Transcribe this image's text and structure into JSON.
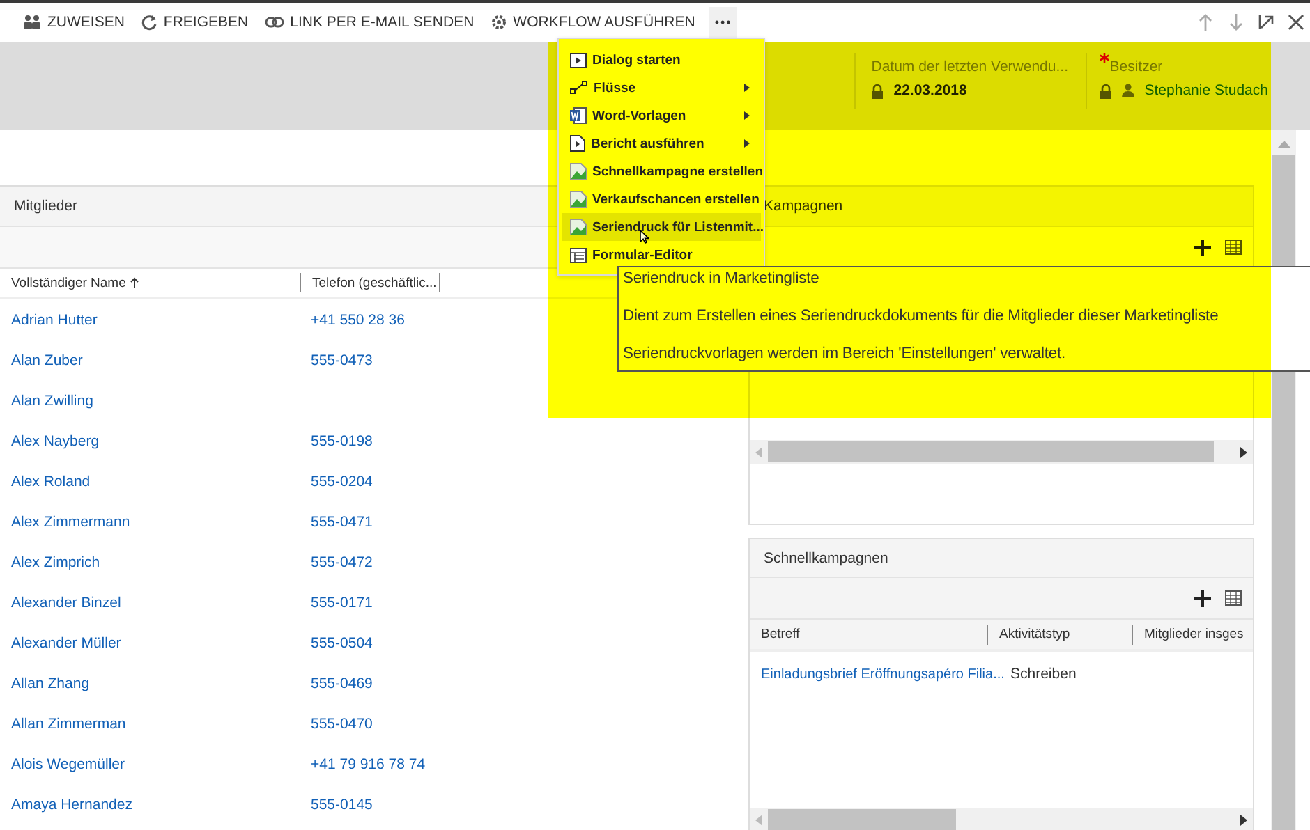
{
  "toolbar": {
    "commands": [
      {
        "label": "ZUWEISEN",
        "kind": "assign"
      },
      {
        "label": "FREIGEBEN",
        "kind": "share"
      },
      {
        "label": "LINK PER E-MAIL SENDEN",
        "kind": "link"
      },
      {
        "label": "WORKFLOW AUSFÜHREN",
        "kind": "workflow"
      }
    ],
    "more": "•••"
  },
  "header": {
    "fields": [
      {
        "label": "Datum der letzten Verwendu...",
        "value": "22.03.2018",
        "locked": true,
        "required": false,
        "kind": "text"
      },
      {
        "label": "Besitzer",
        "value": "Stephanie Studach",
        "locked": true,
        "required": true,
        "kind": "lookup"
      }
    ]
  },
  "members": {
    "title": "Mitglieder",
    "columns": [
      {
        "label": "Vollständiger Name",
        "sorted": true
      },
      {
        "label": "Telefon (geschäftlic...",
        "sorted": false
      }
    ],
    "rows": [
      {
        "name": "Adrian Hutter",
        "phone": "+41 550 28 36"
      },
      {
        "name": "Alan Zuber",
        "phone": "555-0473"
      },
      {
        "name": "Alan Zwilling",
        "phone": ""
      },
      {
        "name": "Alex Nayberg",
        "phone": "555-0198"
      },
      {
        "name": "Alex Roland",
        "phone": "555-0204"
      },
      {
        "name": "Alex Zimmermann",
        "phone": "555-0471"
      },
      {
        "name": "Alex Zimprich",
        "phone": "555-0472"
      },
      {
        "name": "Alexander Binzel",
        "phone": "555-0171"
      },
      {
        "name": "Alexander Müller",
        "phone": "555-0504"
      },
      {
        "name": "Allan Zhang",
        "phone": "555-0469"
      },
      {
        "name": "Allan Zimmerman",
        "phone": "555-0470"
      },
      {
        "name": "Alois Wegemüller",
        "phone": "+41 79 916 78 74"
      },
      {
        "name": "Amaya Hernandez",
        "phone": "555-0145"
      }
    ]
  },
  "campaigns": {
    "title": "Kampagnen"
  },
  "quick_campaigns": {
    "title": "Schnellkampagnen",
    "columns": [
      "Betreff",
      "Aktivitätstyp",
      "Mitglieder insges"
    ],
    "rows": [
      {
        "subject": "Einladungsbrief Eröffnungsapéro Filia...",
        "type": "Schreiben"
      }
    ]
  },
  "menu": {
    "items": [
      {
        "label": "Dialog starten",
        "kind": "dialog",
        "submenu": false,
        "selected": false
      },
      {
        "label": "Flüsse",
        "kind": "flow",
        "submenu": true,
        "selected": false
      },
      {
        "label": "Word-Vorlagen",
        "kind": "word",
        "submenu": true,
        "selected": false
      },
      {
        "label": "Bericht ausführen",
        "kind": "report",
        "submenu": true,
        "selected": false
      },
      {
        "label": "Schnellkampagne erstellen",
        "kind": "image",
        "submenu": false,
        "selected": false
      },
      {
        "label": "Verkaufschancen erstellen",
        "kind": "image",
        "submenu": false,
        "selected": false
      },
      {
        "label": "Seriendruck für Listenmit...",
        "kind": "image",
        "submenu": false,
        "selected": true
      },
      {
        "label": "Formular-Editor",
        "kind": "form",
        "submenu": false,
        "selected": false
      }
    ]
  },
  "tooltip": {
    "title": "Seriendruck in Marketingliste",
    "lines": [
      "Dient zum Erstellen eines Seriendruckdokuments für die Mitglieder dieser Marketingliste",
      "Seriendruckvorlagen werden im Bereich 'Einstellungen' verwaltet."
    ]
  }
}
